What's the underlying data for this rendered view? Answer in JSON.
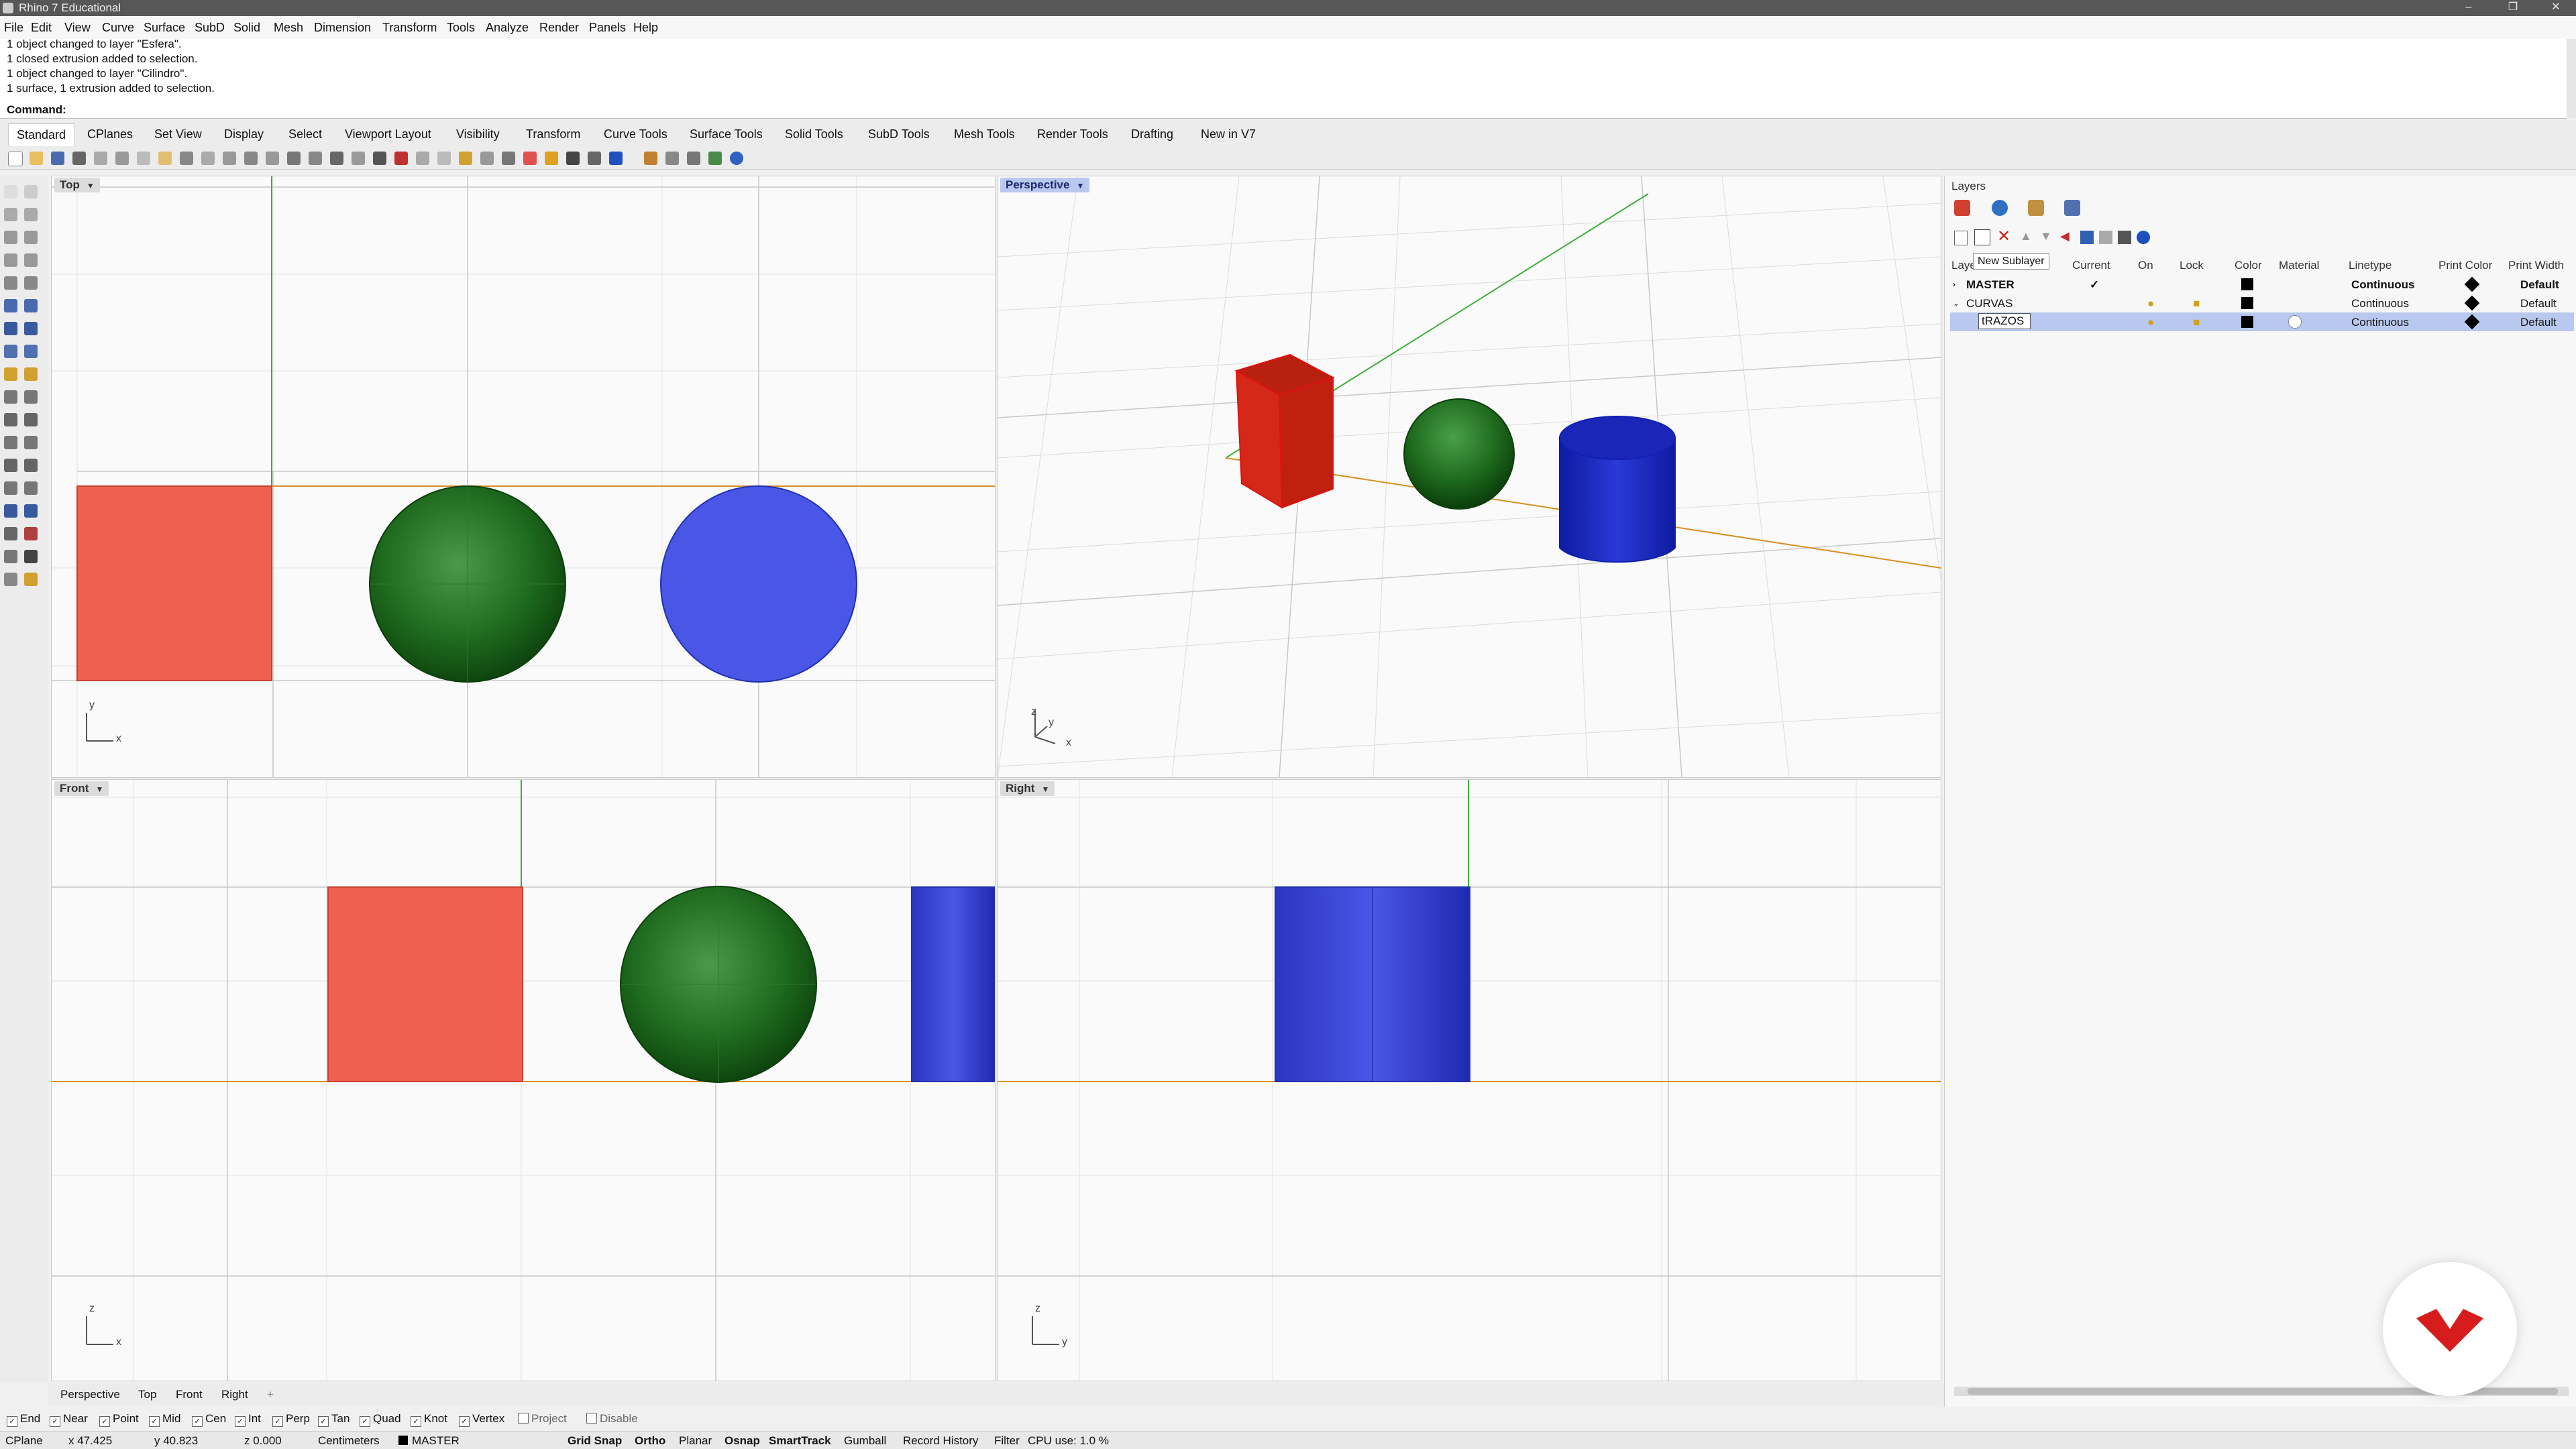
{
  "window": {
    "title": "Rhino 7 Educational"
  },
  "menu": [
    "File",
    "Edit",
    "View",
    "Curve",
    "Surface",
    "SubD",
    "Solid",
    "Mesh",
    "Dimension",
    "Transform",
    "Tools",
    "Analyze",
    "Render",
    "Panels",
    "Help"
  ],
  "history": [
    "1 object changed to layer \"Esfera\".",
    "1 closed extrusion added to selection.",
    "1 object changed to layer \"Cilindro\".",
    "1 surface, 1 extrusion added to selection."
  ],
  "command": {
    "label": "Command:"
  },
  "toolbar_tabs": [
    "Standard",
    "CPlanes",
    "Set View",
    "Display",
    "Select",
    "Viewport Layout",
    "Visibility",
    "Transform",
    "Curve Tools",
    "Surface Tools",
    "Solid Tools",
    "SubD Tools",
    "Mesh Tools",
    "Render Tools",
    "Drafting",
    "New in V7"
  ],
  "viewports": {
    "top": {
      "label": "Top"
    },
    "perspective": {
      "label": "Perspective"
    },
    "front": {
      "label": "Front"
    },
    "right": {
      "label": "Right"
    }
  },
  "axes": {
    "x": "x",
    "y": "y",
    "z": "z"
  },
  "layers": {
    "title": "Layers",
    "tooltip": "New Sublayer",
    "columns": [
      "Laye",
      "Current",
      "On",
      "Lock",
      "Color",
      "Material",
      "Linetype",
      "Print Color",
      "Print Width"
    ],
    "rows": [
      {
        "name": "MASTER",
        "current": "✓",
        "linetype": "Continuous",
        "print_width": "Default"
      },
      {
        "name": "CURVAS",
        "current": "",
        "linetype": "Continuous",
        "print_width": "Default"
      },
      {
        "name": "tRAZOS",
        "current": "",
        "linetype": "Continuous",
        "print_width": "Default"
      }
    ]
  },
  "viewport_tabs": [
    "Perspective",
    "Top",
    "Front",
    "Right",
    "+"
  ],
  "osnaps": [
    {
      "label": "End",
      "checked": true
    },
    {
      "label": "Near",
      "checked": true
    },
    {
      "label": "Point",
      "checked": true
    },
    {
      "label": "Mid",
      "checked": true
    },
    {
      "label": "Cen",
      "checked": true
    },
    {
      "label": "Int",
      "checked": true
    },
    {
      "label": "Perp",
      "checked": true
    },
    {
      "label": "Tan",
      "checked": true
    },
    {
      "label": "Quad",
      "checked": true
    },
    {
      "label": "Knot",
      "checked": true
    },
    {
      "label": "Vertex",
      "checked": true
    },
    {
      "label": "Project",
      "checked": false
    },
    {
      "label": "Disable",
      "checked": false
    }
  ],
  "status": {
    "cplane": "CPlane",
    "x": "x 47.425",
    "y": "y 40.823",
    "z": "z 0.000",
    "units": "Centimeters",
    "layer": "MASTER",
    "modes": [
      "Grid Snap",
      "Ortho",
      "Planar",
      "Osnap",
      "SmartTrack",
      "Gumball",
      "Record History",
      "Filter"
    ],
    "cpu": "CPU use: 1.0 %"
  },
  "colors": {
    "box": "#f06050",
    "sphere": "#1e6a1e",
    "cylinder": "#3a4ae0",
    "selection": "#b8c8ee",
    "x_axis": "#d89020",
    "y_axis": "#3ab03a",
    "logo": "#d61c1c"
  }
}
